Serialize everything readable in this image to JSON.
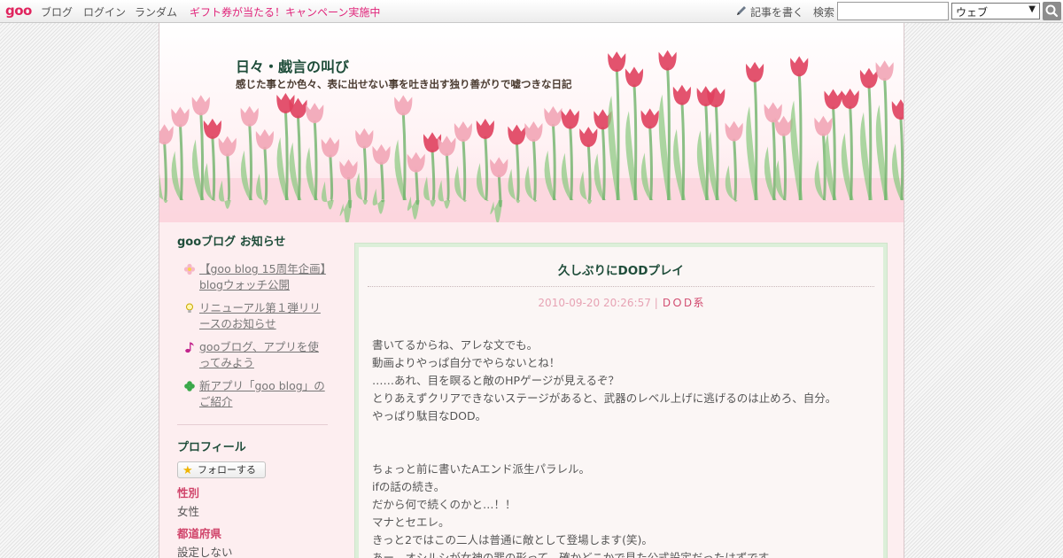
{
  "toolbar": {
    "logo": "goo",
    "links": [
      "ブログ",
      "ログイン",
      "ランダム"
    ],
    "campaign": "ギフト券が当たる！キャンペーン実施中",
    "write_label": "記事を書く",
    "search_label": "検索",
    "search_value": "",
    "search_scope": "ウェブ",
    "icons": [
      "pencil-icon",
      "search-icon"
    ]
  },
  "header": {
    "blog_title": "日々・戯言の叫び",
    "description": "感じた事とか色々、表に出せない事を吐き出す独り善がりで嘘つきな日記"
  },
  "sidebar": {
    "notice_heading": "gooブログ お知らせ",
    "notices": [
      {
        "label": "【goo blog 15周年企画】blogウォッチ公開",
        "icon": "flower-icon"
      },
      {
        "label": "リニューアル第１弾リリースのお知らせ",
        "icon": "lightbulb-icon"
      },
      {
        "label": "gooブログ、アプリを使ってみよう",
        "icon": "music-note-icon"
      },
      {
        "label": "新アプリ「goo blog」のご紹介",
        "icon": "clover-icon"
      }
    ],
    "profile_heading": "プロフィール",
    "follow_label": "フォローする",
    "profile": [
      {
        "label": "性別",
        "value": "女性"
      },
      {
        "label": "都道府県",
        "value": "設定しない"
      }
    ]
  },
  "post": {
    "title": "久しぶりにDODプレイ",
    "datetime": "2010-09-20 20:26:57",
    "separator": " | ",
    "category": "ＤＯＤ系",
    "paragraphs": [
      [
        "書いてるからね、アレな文でも。",
        "動画よりやっぱ自分でやらないとね！",
        "……あれ、目を瞑ると敵のHPゲージが見えるぞ？",
        "とりあえずクリアできないステージがあると、武器のレベル上げに逃げるのは止めろ、自分。",
        "やっぱり駄目なDOD。"
      ],
      [
        "ちょっと前に書いたAエンド派生パラレル。",
        "ifの話の続き。",
        "だから何で続くのかと…！！",
        "マナとセエレ。",
        "きっと2ではこの二人は普通に敵として登場します(笑)。",
        "あー、オシルシが女神の罪の形って、確かどこかで見た公式設定だったはずです。"
      ]
    ]
  },
  "colors": {
    "brand": "#e0245e",
    "campaign": "#e0247a",
    "title_green": "#1f4d3a",
    "accent_pink": "#d0446a",
    "post_border": "#dcefd9"
  }
}
